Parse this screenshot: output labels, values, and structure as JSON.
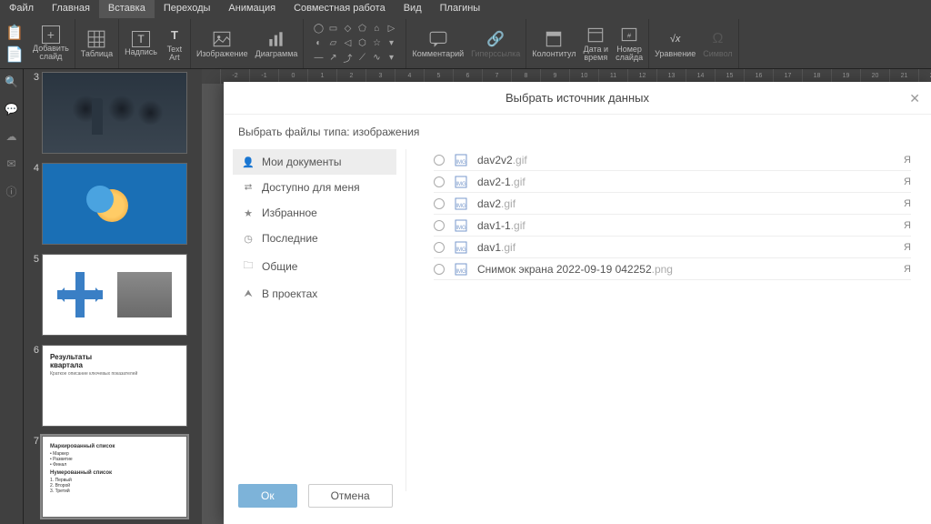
{
  "menu": {
    "items": [
      "Файл",
      "Главная",
      "Вставка",
      "Переходы",
      "Анимация",
      "Совместная работа",
      "Вид",
      "Плагины"
    ],
    "active": 2
  },
  "ribbon": {
    "addSlide": "Добавить\nслайд",
    "table": "Таблица",
    "textbox": "Надпись",
    "textart": "Text\nArt",
    "image": "Изображение",
    "diagram": "Диаграмма",
    "comment": "Комментарий",
    "hyperlink": "Гиперссылка",
    "header": "Колонтитул",
    "datetime": "Дата и\nвремя",
    "slidenum": "Номер\nслайда",
    "equation": "Уравнение",
    "symbol": "Символ"
  },
  "slides": [
    3,
    4,
    5,
    6,
    7
  ],
  "slide6": {
    "title": "Результаты\nквартала",
    "sub": "Краткое описание ключевых показателей"
  },
  "slide7": {
    "h1": "Маркированный список",
    "b": [
      "Маркер",
      "Развитие",
      "Финал"
    ],
    "h2": "Нумерованный список",
    "n": [
      "Первый",
      "Второй",
      "Третий"
    ]
  },
  "dialog": {
    "title": "Выбрать источник данных",
    "filter": "Выбрать файлы типа: изображения",
    "nav": [
      {
        "icon": "user",
        "label": "Мои документы",
        "sel": true
      },
      {
        "icon": "share",
        "label": "Доступно для меня"
      },
      {
        "icon": "star",
        "label": "Избранное"
      },
      {
        "icon": "clock",
        "label": "Последние"
      },
      {
        "icon": "folder",
        "label": "Общие"
      },
      {
        "icon": "proj",
        "label": "В проектах"
      }
    ],
    "files": [
      {
        "name": "dav2v2",
        "ext": ".gif",
        "user": "Я"
      },
      {
        "name": "dav2-1",
        "ext": ".gif",
        "user": "Я"
      },
      {
        "name": "dav2",
        "ext": ".gif",
        "user": "Я"
      },
      {
        "name": "dav1-1",
        "ext": ".gif",
        "user": "Я"
      },
      {
        "name": "dav1",
        "ext": ".gif",
        "user": "Я"
      },
      {
        "name": "Снимок экрана 2022-09-19 042252",
        "ext": ".png",
        "user": "Я"
      }
    ],
    "ok": "Ок",
    "cancel": "Отмена"
  }
}
